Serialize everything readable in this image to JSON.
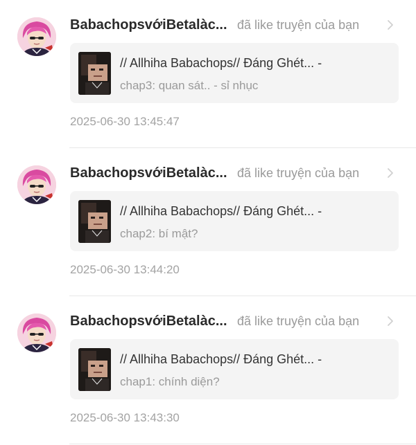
{
  "notifications": [
    {
      "user_name": "BabachopsvớiBetalàc...",
      "action": "đã like truyện của bạn",
      "story_title": "// Allhiha Babachops// Đáng Ghét... -",
      "chapter": "chap3: quan sát.. - sỉ nhục",
      "time": "2025-06-30 13:45:47",
      "avatar_icon": "user-avatar",
      "thumb_icon": "story-cover"
    },
    {
      "user_name": "BabachopsvớiBetalàc...",
      "action": "đã like truyện của bạn",
      "story_title": "// Allhiha Babachops// Đáng Ghét... -",
      "chapter": "chap2: bí mật?",
      "time": "2025-06-30 13:44:20",
      "avatar_icon": "user-avatar",
      "thumb_icon": "story-cover"
    },
    {
      "user_name": "BabachopsvớiBetalàc...",
      "action": "đã like truyện của bạn",
      "story_title": "// Allhiha Babachops// Đáng Ghét... -",
      "chapter": "chap1: chính diện?",
      "time": "2025-06-30 13:43:30",
      "avatar_icon": "user-avatar",
      "thumb_icon": "story-cover"
    }
  ],
  "colors": {
    "card_bg": "#f4f4f4",
    "name_text": "#2a2a2a",
    "muted_text": "#9a9a9a",
    "divider": "#e8e8e8",
    "avatar_hair": "#d94aa0"
  }
}
